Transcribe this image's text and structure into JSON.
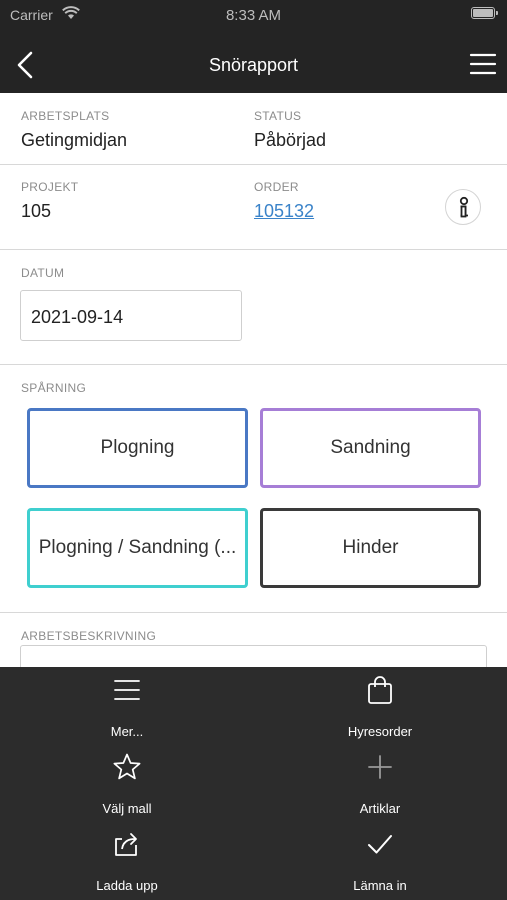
{
  "statusbar": {
    "carrier": "Carrier",
    "time": "8:33 AM"
  },
  "header": {
    "title": "Snörapport"
  },
  "info": {
    "workplace_label": "ARBETSPLATS",
    "workplace_value": "Getingmidjan",
    "status_label": "STATUS",
    "status_value": "Påbörjad",
    "project_label": "PROJEKT",
    "project_value": "105",
    "order_label": "ORDER",
    "order_value": "105132"
  },
  "date": {
    "label": "DATUM",
    "value": "2021-09-14"
  },
  "tracking": {
    "label": "SPÅRNING",
    "buttons": [
      {
        "label": "Plogning",
        "color": "#4a78c4"
      },
      {
        "label": "Sandning",
        "color": "#a67ed6"
      },
      {
        "label": "Plogning / Sandning (...",
        "color": "#3fcfcf"
      },
      {
        "label": "Hinder",
        "color": "#3a3a3a"
      }
    ]
  },
  "description": {
    "label": "ARBETSBESKRIVNING",
    "value": ""
  },
  "bottom_menu": {
    "items": [
      {
        "label": "Mer...",
        "icon": "menu-icon"
      },
      {
        "label": "Hyresorder",
        "icon": "bag-icon"
      },
      {
        "label": "Välj mall",
        "icon": "star-icon"
      },
      {
        "label": "Artiklar",
        "icon": "plus-icon"
      },
      {
        "label": "Ladda upp",
        "icon": "share-icon"
      },
      {
        "label": "Lämna in",
        "icon": "checkmark-icon"
      }
    ]
  }
}
